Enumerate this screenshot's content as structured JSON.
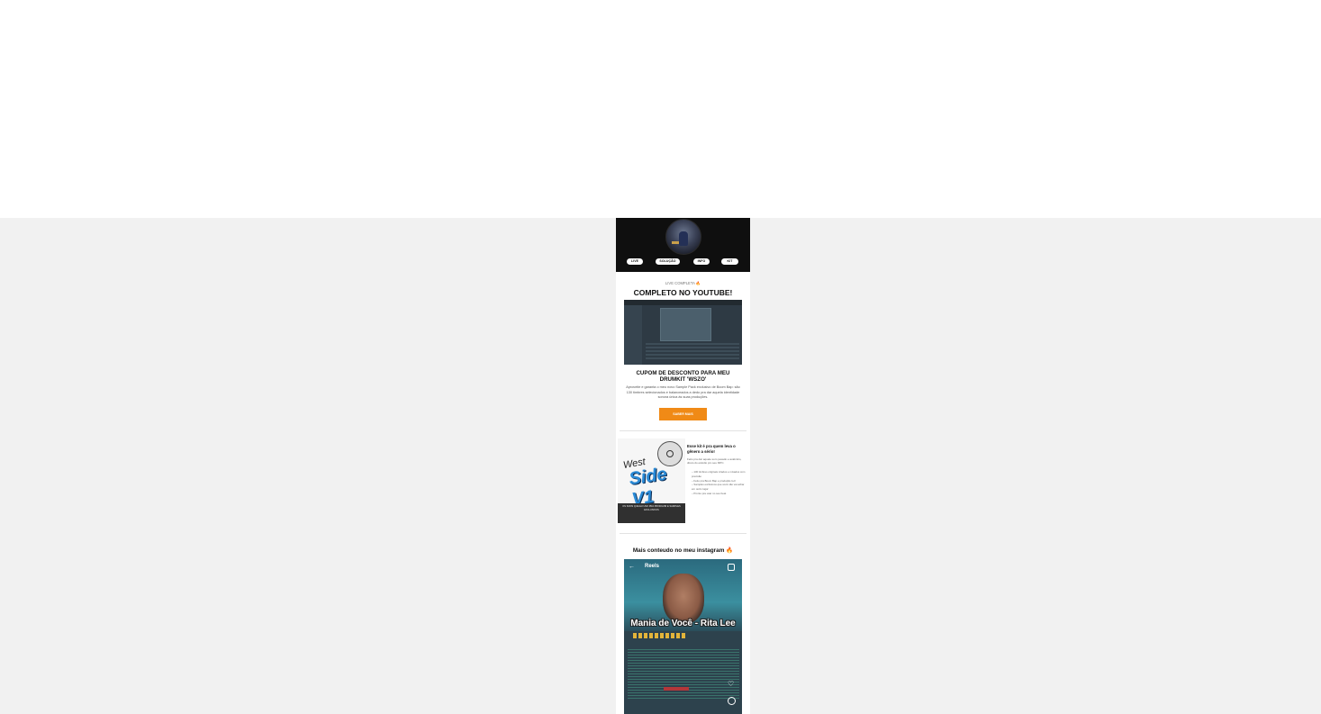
{
  "hero": {
    "avatar_alt": "profile-photo",
    "links": [
      "LIVE",
      "SOLUÇÃO",
      "INFO",
      "KIT"
    ]
  },
  "youtube": {
    "label": "LIVE COMPLETA",
    "title": "COMPLETO NO YOUTUBE!"
  },
  "coupon": {
    "title": "CUPOM DE DESCONTO PARA MEU DRUMKIT 'WSZO'",
    "text": "Aproveite e garanta o meu novo Sample Pack exclusivo de Boom Bap: são 130 timbres selecionados e balanceados a dedo pra dar aquela identidade sonora única às suas produções.",
    "button_label": "SABER MAIS"
  },
  "kit": {
    "image_title": "West Side V1",
    "image_band": "OS SONS QUE EU USO PRA PRODUZIR E SAMPLES EXCLUSIVOS",
    "title": "Esse kit é pra quem leva o gênero a sério!",
    "description": "Feito pra dar aquele som pesado e autêntico, direto do estúdio pro seu MPC.",
    "list": [
      "– 130 timbres originais criados e mixados com precisão",
      "– Feito pra Boom Bap e produção lo-fi",
      "– Samples exclusivos que você não vai achar em outro lugar",
      "– Pronto pra usar no seu beat"
    ]
  },
  "instagram": {
    "title": "Mais conteudo no meu instagram",
    "reels_label": "Reels",
    "caption": "Mania de Você - Rita Lee"
  },
  "colors": {
    "page_bg": "#ffffff",
    "gray_bg": "#f1f1f1",
    "hero_bg": "#0f0f0f",
    "accent": "#f08a16"
  }
}
